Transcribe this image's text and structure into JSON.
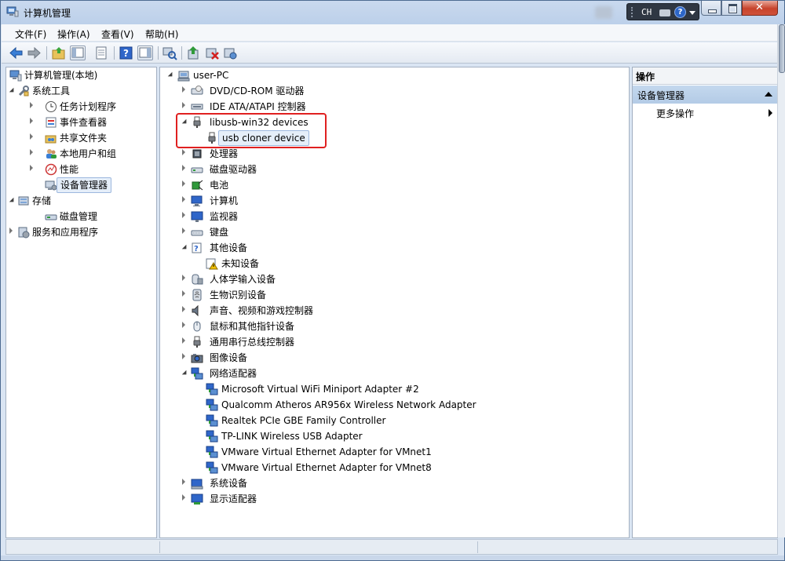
{
  "window": {
    "title": "计算机管理",
    "lang_indicator": "CH"
  },
  "menu": [
    "文件(F)",
    "操作(A)",
    "查看(V)",
    "帮助(H)"
  ],
  "toolbar": {
    "buttons": [
      "back-icon",
      "forward-icon",
      "up-folder-icon",
      "show-hide-tree-icon",
      "properties-icon",
      "help-icon",
      "show-hide-action-pane-icon",
      "scan-hardware-icon",
      "update-driver-icon",
      "disable-device-icon",
      "uninstall-device-icon"
    ]
  },
  "left_tree": {
    "root": "计算机管理(本地)",
    "items": [
      {
        "label": "系统工具",
        "level": 1,
        "expanded": true
      },
      {
        "label": "任务计划程序",
        "level": 2
      },
      {
        "label": "事件查看器",
        "level": 2
      },
      {
        "label": "共享文件夹",
        "level": 2
      },
      {
        "label": "本地用户和组",
        "level": 2
      },
      {
        "label": "性能",
        "level": 2
      },
      {
        "label": "设备管理器",
        "level": 2,
        "selected": true
      },
      {
        "label": "存储",
        "level": 1,
        "expanded": true
      },
      {
        "label": "磁盘管理",
        "level": 2
      },
      {
        "label": "服务和应用程序",
        "level": 1
      }
    ]
  },
  "device_tree": {
    "root": "user-PC",
    "categories": [
      {
        "label": "DVD/CD-ROM 驱动器",
        "icon": "dvd-drive-icon"
      },
      {
        "label": "IDE ATA/ATAPI 控制器",
        "icon": "ide-controller-icon"
      },
      {
        "label": "libusb-win32 devices",
        "icon": "usb-plug-icon",
        "expanded": true,
        "children": [
          {
            "label": "usb cloner device",
            "icon": "usb-plug-icon",
            "selected": true
          }
        ]
      },
      {
        "label": "处理器",
        "icon": "processor-icon"
      },
      {
        "label": "磁盘驱动器",
        "icon": "disk-drive-icon"
      },
      {
        "label": "电池",
        "icon": "battery-icon"
      },
      {
        "label": "计算机",
        "icon": "computer-icon"
      },
      {
        "label": "监视器",
        "icon": "monitor-icon"
      },
      {
        "label": "键盘",
        "icon": "keyboard-icon"
      },
      {
        "label": "其他设备",
        "icon": "unknown-device-icon",
        "expanded": true,
        "children": [
          {
            "label": "未知设备",
            "icon": "warning-device-icon"
          }
        ]
      },
      {
        "label": "人体学输入设备",
        "icon": "hid-icon"
      },
      {
        "label": "生物识别设备",
        "icon": "biometric-icon"
      },
      {
        "label": "声音、视频和游戏控制器",
        "icon": "speaker-icon"
      },
      {
        "label": "鼠标和其他指针设备",
        "icon": "mouse-icon"
      },
      {
        "label": "通用串行总线控制器",
        "icon": "usb-plug-icon"
      },
      {
        "label": "图像设备",
        "icon": "camera-icon"
      },
      {
        "label": "网络适配器",
        "icon": "network-adapter-icon",
        "expanded": true,
        "children": [
          {
            "label": "Microsoft Virtual WiFi Miniport Adapter #2",
            "icon": "network-adapter-icon"
          },
          {
            "label": "Qualcomm Atheros AR956x Wireless Network Adapter",
            "icon": "network-adapter-icon"
          },
          {
            "label": "Realtek PCIe GBE Family Controller",
            "icon": "network-adapter-icon"
          },
          {
            "label": "TP-LINK Wireless USB Adapter",
            "icon": "network-adapter-icon"
          },
          {
            "label": "VMware Virtual Ethernet Adapter for VMnet1",
            "icon": "network-adapter-icon"
          },
          {
            "label": "VMware Virtual Ethernet Adapter for VMnet8",
            "icon": "network-adapter-icon"
          }
        ]
      },
      {
        "label": "系统设备",
        "icon": "system-device-icon"
      },
      {
        "label": "显示适配器",
        "icon": "display-adapter-icon"
      }
    ]
  },
  "actions": {
    "header": "操作",
    "section": "设备管理器",
    "more": "更多操作"
  },
  "colors": {
    "highlight_box": "#e02020",
    "selection": "#e5eef9",
    "action_section": "#c4d8ee"
  }
}
